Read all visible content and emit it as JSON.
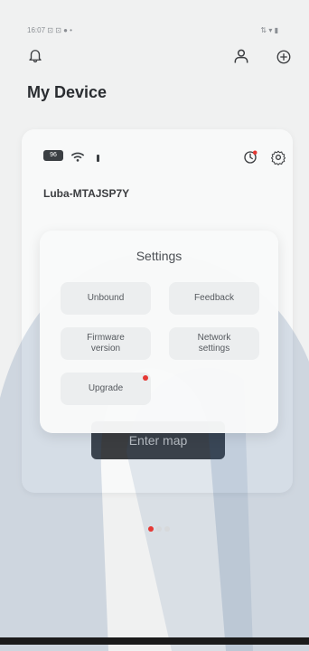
{
  "status_bar": {
    "time": "16:07",
    "left_indicators": "⊡ ⊡ ● •",
    "right_indicators": "⇅ ▾ ▮"
  },
  "header": {
    "bell_icon": "bell-icon",
    "user_icon": "user-icon",
    "add_icon": "plus-circle-icon"
  },
  "page": {
    "title": "My Device"
  },
  "device_card": {
    "battery": "96",
    "name": "Luba-MTAJSP7Y",
    "enter_map_label": "Enter map"
  },
  "settings_modal": {
    "title": "Settings",
    "options": [
      {
        "label": "Unbound"
      },
      {
        "label": "Feedback"
      },
      {
        "label": "Firmware\nversion"
      },
      {
        "label": "Network\nsettings"
      },
      {
        "label": "Upgrade"
      }
    ]
  },
  "pager": {
    "total": 3,
    "active_index": 0
  },
  "colors": {
    "accent_red": "#e53935",
    "dark_button": "#3b3d40",
    "watermark_blue": "#3a5f90"
  }
}
